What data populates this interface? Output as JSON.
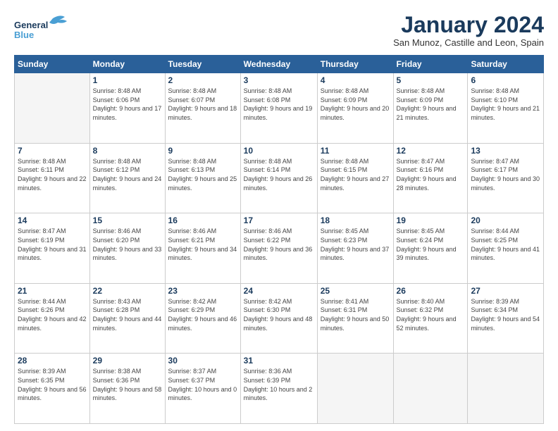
{
  "logo": {
    "line1": "General",
    "line2": "Blue"
  },
  "title": "January 2024",
  "subtitle": "San Munoz, Castille and Leon, Spain",
  "weekdays": [
    "Sunday",
    "Monday",
    "Tuesday",
    "Wednesday",
    "Thursday",
    "Friday",
    "Saturday"
  ],
  "weeks": [
    [
      {
        "day": "",
        "sunrise": "",
        "sunset": "",
        "daylight": ""
      },
      {
        "day": "1",
        "sunrise": "Sunrise: 8:48 AM",
        "sunset": "Sunset: 6:06 PM",
        "daylight": "Daylight: 9 hours and 17 minutes."
      },
      {
        "day": "2",
        "sunrise": "Sunrise: 8:48 AM",
        "sunset": "Sunset: 6:07 PM",
        "daylight": "Daylight: 9 hours and 18 minutes."
      },
      {
        "day": "3",
        "sunrise": "Sunrise: 8:48 AM",
        "sunset": "Sunset: 6:08 PM",
        "daylight": "Daylight: 9 hours and 19 minutes."
      },
      {
        "day": "4",
        "sunrise": "Sunrise: 8:48 AM",
        "sunset": "Sunset: 6:09 PM",
        "daylight": "Daylight: 9 hours and 20 minutes."
      },
      {
        "day": "5",
        "sunrise": "Sunrise: 8:48 AM",
        "sunset": "Sunset: 6:09 PM",
        "daylight": "Daylight: 9 hours and 21 minutes."
      },
      {
        "day": "6",
        "sunrise": "Sunrise: 8:48 AM",
        "sunset": "Sunset: 6:10 PM",
        "daylight": "Daylight: 9 hours and 21 minutes."
      }
    ],
    [
      {
        "day": "7",
        "sunrise": "Sunrise: 8:48 AM",
        "sunset": "Sunset: 6:11 PM",
        "daylight": "Daylight: 9 hours and 22 minutes."
      },
      {
        "day": "8",
        "sunrise": "Sunrise: 8:48 AM",
        "sunset": "Sunset: 6:12 PM",
        "daylight": "Daylight: 9 hours and 24 minutes."
      },
      {
        "day": "9",
        "sunrise": "Sunrise: 8:48 AM",
        "sunset": "Sunset: 6:13 PM",
        "daylight": "Daylight: 9 hours and 25 minutes."
      },
      {
        "day": "10",
        "sunrise": "Sunrise: 8:48 AM",
        "sunset": "Sunset: 6:14 PM",
        "daylight": "Daylight: 9 hours and 26 minutes."
      },
      {
        "day": "11",
        "sunrise": "Sunrise: 8:48 AM",
        "sunset": "Sunset: 6:15 PM",
        "daylight": "Daylight: 9 hours and 27 minutes."
      },
      {
        "day": "12",
        "sunrise": "Sunrise: 8:47 AM",
        "sunset": "Sunset: 6:16 PM",
        "daylight": "Daylight: 9 hours and 28 minutes."
      },
      {
        "day": "13",
        "sunrise": "Sunrise: 8:47 AM",
        "sunset": "Sunset: 6:17 PM",
        "daylight": "Daylight: 9 hours and 30 minutes."
      }
    ],
    [
      {
        "day": "14",
        "sunrise": "Sunrise: 8:47 AM",
        "sunset": "Sunset: 6:19 PM",
        "daylight": "Daylight: 9 hours and 31 minutes."
      },
      {
        "day": "15",
        "sunrise": "Sunrise: 8:46 AM",
        "sunset": "Sunset: 6:20 PM",
        "daylight": "Daylight: 9 hours and 33 minutes."
      },
      {
        "day": "16",
        "sunrise": "Sunrise: 8:46 AM",
        "sunset": "Sunset: 6:21 PM",
        "daylight": "Daylight: 9 hours and 34 minutes."
      },
      {
        "day": "17",
        "sunrise": "Sunrise: 8:46 AM",
        "sunset": "Sunset: 6:22 PM",
        "daylight": "Daylight: 9 hours and 36 minutes."
      },
      {
        "day": "18",
        "sunrise": "Sunrise: 8:45 AM",
        "sunset": "Sunset: 6:23 PM",
        "daylight": "Daylight: 9 hours and 37 minutes."
      },
      {
        "day": "19",
        "sunrise": "Sunrise: 8:45 AM",
        "sunset": "Sunset: 6:24 PM",
        "daylight": "Daylight: 9 hours and 39 minutes."
      },
      {
        "day": "20",
        "sunrise": "Sunrise: 8:44 AM",
        "sunset": "Sunset: 6:25 PM",
        "daylight": "Daylight: 9 hours and 41 minutes."
      }
    ],
    [
      {
        "day": "21",
        "sunrise": "Sunrise: 8:44 AM",
        "sunset": "Sunset: 6:26 PM",
        "daylight": "Daylight: 9 hours and 42 minutes."
      },
      {
        "day": "22",
        "sunrise": "Sunrise: 8:43 AM",
        "sunset": "Sunset: 6:28 PM",
        "daylight": "Daylight: 9 hours and 44 minutes."
      },
      {
        "day": "23",
        "sunrise": "Sunrise: 8:42 AM",
        "sunset": "Sunset: 6:29 PM",
        "daylight": "Daylight: 9 hours and 46 minutes."
      },
      {
        "day": "24",
        "sunrise": "Sunrise: 8:42 AM",
        "sunset": "Sunset: 6:30 PM",
        "daylight": "Daylight: 9 hours and 48 minutes."
      },
      {
        "day": "25",
        "sunrise": "Sunrise: 8:41 AM",
        "sunset": "Sunset: 6:31 PM",
        "daylight": "Daylight: 9 hours and 50 minutes."
      },
      {
        "day": "26",
        "sunrise": "Sunrise: 8:40 AM",
        "sunset": "Sunset: 6:32 PM",
        "daylight": "Daylight: 9 hours and 52 minutes."
      },
      {
        "day": "27",
        "sunrise": "Sunrise: 8:39 AM",
        "sunset": "Sunset: 6:34 PM",
        "daylight": "Daylight: 9 hours and 54 minutes."
      }
    ],
    [
      {
        "day": "28",
        "sunrise": "Sunrise: 8:39 AM",
        "sunset": "Sunset: 6:35 PM",
        "daylight": "Daylight: 9 hours and 56 minutes."
      },
      {
        "day": "29",
        "sunrise": "Sunrise: 8:38 AM",
        "sunset": "Sunset: 6:36 PM",
        "daylight": "Daylight: 9 hours and 58 minutes."
      },
      {
        "day": "30",
        "sunrise": "Sunrise: 8:37 AM",
        "sunset": "Sunset: 6:37 PM",
        "daylight": "Daylight: 10 hours and 0 minutes."
      },
      {
        "day": "31",
        "sunrise": "Sunrise: 8:36 AM",
        "sunset": "Sunset: 6:39 PM",
        "daylight": "Daylight: 10 hours and 2 minutes."
      },
      {
        "day": "",
        "sunrise": "",
        "sunset": "",
        "daylight": ""
      },
      {
        "day": "",
        "sunrise": "",
        "sunset": "",
        "daylight": ""
      },
      {
        "day": "",
        "sunrise": "",
        "sunset": "",
        "daylight": ""
      }
    ]
  ]
}
